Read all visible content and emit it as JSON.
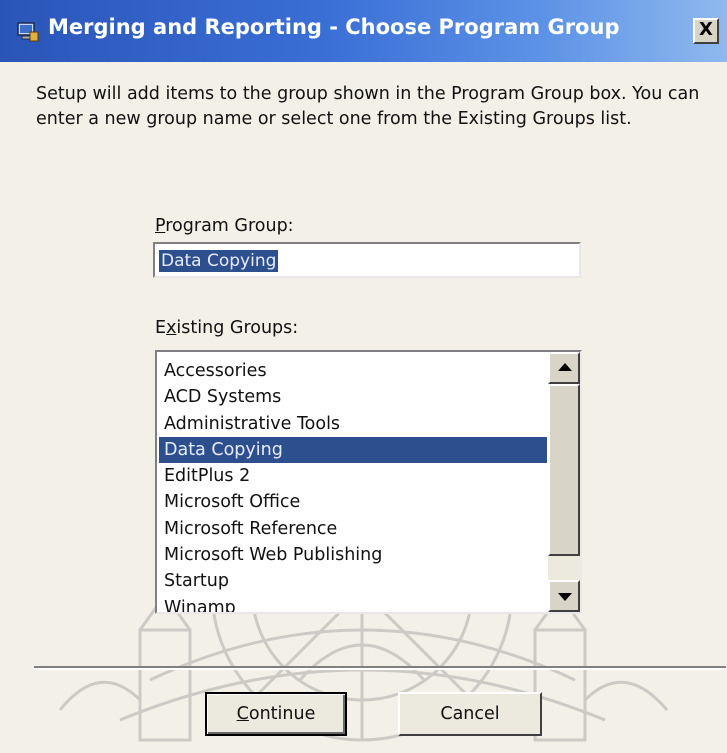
{
  "window": {
    "title": "Merging and Reporting - Choose Program Group",
    "close_label": "X"
  },
  "intro": {
    "text": "Setup will add items to the group shown in the Program Group box. You can enter a new group name or select one from the Existing Groups list."
  },
  "program_group": {
    "label_prefix": "",
    "label_underlined": "P",
    "label_rest": "rogram Group:",
    "value": "Data Copying"
  },
  "existing_groups": {
    "label_prefix": "E",
    "label_underlined": "x",
    "label_rest": "isting Groups:",
    "items": [
      "Accessories",
      "ACD Systems",
      "Administrative Tools",
      "Data Copying",
      "EditPlus 2",
      "Microsoft Office",
      "Microsoft Reference",
      "Microsoft Web Publishing",
      "Startup",
      "Winamp"
    ],
    "selected": "Data Copying"
  },
  "buttons": {
    "continue_underlined": "C",
    "continue_rest": "ontinue",
    "cancel": "Cancel"
  },
  "colors": {
    "titlebar_start": "#2a55b8",
    "titlebar_end": "#8fb8ee",
    "selection": "#2d4f8e",
    "dialog_bg": "#f3f0e8"
  }
}
